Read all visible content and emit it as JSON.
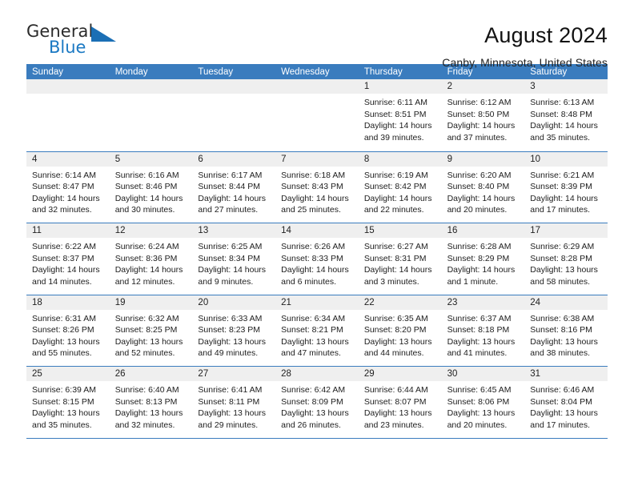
{
  "brand": {
    "name_top": "General",
    "name_bottom": "Blue",
    "accent_color": "#1b79c3",
    "triangle_color": "#1b6fb5"
  },
  "header": {
    "title": "August 2024",
    "subtitle": "Canby, Minnesota, United States",
    "header_bg_color": "#3a7cbe",
    "daynum_bg_color": "#efefef"
  },
  "weekdays": [
    "Sunday",
    "Monday",
    "Tuesday",
    "Wednesday",
    "Thursday",
    "Friday",
    "Saturday"
  ],
  "weeks": [
    [
      {
        "day": "",
        "lines": []
      },
      {
        "day": "",
        "lines": []
      },
      {
        "day": "",
        "lines": []
      },
      {
        "day": "",
        "lines": []
      },
      {
        "day": "1",
        "lines": [
          "Sunrise: 6:11 AM",
          "Sunset: 8:51 PM",
          "Daylight: 14 hours",
          "and 39 minutes."
        ]
      },
      {
        "day": "2",
        "lines": [
          "Sunrise: 6:12 AM",
          "Sunset: 8:50 PM",
          "Daylight: 14 hours",
          "and 37 minutes."
        ]
      },
      {
        "day": "3",
        "lines": [
          "Sunrise: 6:13 AM",
          "Sunset: 8:48 PM",
          "Daylight: 14 hours",
          "and 35 minutes."
        ]
      }
    ],
    [
      {
        "day": "4",
        "lines": [
          "Sunrise: 6:14 AM",
          "Sunset: 8:47 PM",
          "Daylight: 14 hours",
          "and 32 minutes."
        ]
      },
      {
        "day": "5",
        "lines": [
          "Sunrise: 6:16 AM",
          "Sunset: 8:46 PM",
          "Daylight: 14 hours",
          "and 30 minutes."
        ]
      },
      {
        "day": "6",
        "lines": [
          "Sunrise: 6:17 AM",
          "Sunset: 8:44 PM",
          "Daylight: 14 hours",
          "and 27 minutes."
        ]
      },
      {
        "day": "7",
        "lines": [
          "Sunrise: 6:18 AM",
          "Sunset: 8:43 PM",
          "Daylight: 14 hours",
          "and 25 minutes."
        ]
      },
      {
        "day": "8",
        "lines": [
          "Sunrise: 6:19 AM",
          "Sunset: 8:42 PM",
          "Daylight: 14 hours",
          "and 22 minutes."
        ]
      },
      {
        "day": "9",
        "lines": [
          "Sunrise: 6:20 AM",
          "Sunset: 8:40 PM",
          "Daylight: 14 hours",
          "and 20 minutes."
        ]
      },
      {
        "day": "10",
        "lines": [
          "Sunrise: 6:21 AM",
          "Sunset: 8:39 PM",
          "Daylight: 14 hours",
          "and 17 minutes."
        ]
      }
    ],
    [
      {
        "day": "11",
        "lines": [
          "Sunrise: 6:22 AM",
          "Sunset: 8:37 PM",
          "Daylight: 14 hours",
          "and 14 minutes."
        ]
      },
      {
        "day": "12",
        "lines": [
          "Sunrise: 6:24 AM",
          "Sunset: 8:36 PM",
          "Daylight: 14 hours",
          "and 12 minutes."
        ]
      },
      {
        "day": "13",
        "lines": [
          "Sunrise: 6:25 AM",
          "Sunset: 8:34 PM",
          "Daylight: 14 hours",
          "and 9 minutes."
        ]
      },
      {
        "day": "14",
        "lines": [
          "Sunrise: 6:26 AM",
          "Sunset: 8:33 PM",
          "Daylight: 14 hours",
          "and 6 minutes."
        ]
      },
      {
        "day": "15",
        "lines": [
          "Sunrise: 6:27 AM",
          "Sunset: 8:31 PM",
          "Daylight: 14 hours",
          "and 3 minutes."
        ]
      },
      {
        "day": "16",
        "lines": [
          "Sunrise: 6:28 AM",
          "Sunset: 8:29 PM",
          "Daylight: 14 hours",
          "and 1 minute."
        ]
      },
      {
        "day": "17",
        "lines": [
          "Sunrise: 6:29 AM",
          "Sunset: 8:28 PM",
          "Daylight: 13 hours",
          "and 58 minutes."
        ]
      }
    ],
    [
      {
        "day": "18",
        "lines": [
          "Sunrise: 6:31 AM",
          "Sunset: 8:26 PM",
          "Daylight: 13 hours",
          "and 55 minutes."
        ]
      },
      {
        "day": "19",
        "lines": [
          "Sunrise: 6:32 AM",
          "Sunset: 8:25 PM",
          "Daylight: 13 hours",
          "and 52 minutes."
        ]
      },
      {
        "day": "20",
        "lines": [
          "Sunrise: 6:33 AM",
          "Sunset: 8:23 PM",
          "Daylight: 13 hours",
          "and 49 minutes."
        ]
      },
      {
        "day": "21",
        "lines": [
          "Sunrise: 6:34 AM",
          "Sunset: 8:21 PM",
          "Daylight: 13 hours",
          "and 47 minutes."
        ]
      },
      {
        "day": "22",
        "lines": [
          "Sunrise: 6:35 AM",
          "Sunset: 8:20 PM",
          "Daylight: 13 hours",
          "and 44 minutes."
        ]
      },
      {
        "day": "23",
        "lines": [
          "Sunrise: 6:37 AM",
          "Sunset: 8:18 PM",
          "Daylight: 13 hours",
          "and 41 minutes."
        ]
      },
      {
        "day": "24",
        "lines": [
          "Sunrise: 6:38 AM",
          "Sunset: 8:16 PM",
          "Daylight: 13 hours",
          "and 38 minutes."
        ]
      }
    ],
    [
      {
        "day": "25",
        "lines": [
          "Sunrise: 6:39 AM",
          "Sunset: 8:15 PM",
          "Daylight: 13 hours",
          "and 35 minutes."
        ]
      },
      {
        "day": "26",
        "lines": [
          "Sunrise: 6:40 AM",
          "Sunset: 8:13 PM",
          "Daylight: 13 hours",
          "and 32 minutes."
        ]
      },
      {
        "day": "27",
        "lines": [
          "Sunrise: 6:41 AM",
          "Sunset: 8:11 PM",
          "Daylight: 13 hours",
          "and 29 minutes."
        ]
      },
      {
        "day": "28",
        "lines": [
          "Sunrise: 6:42 AM",
          "Sunset: 8:09 PM",
          "Daylight: 13 hours",
          "and 26 minutes."
        ]
      },
      {
        "day": "29",
        "lines": [
          "Sunrise: 6:44 AM",
          "Sunset: 8:07 PM",
          "Daylight: 13 hours",
          "and 23 minutes."
        ]
      },
      {
        "day": "30",
        "lines": [
          "Sunrise: 6:45 AM",
          "Sunset: 8:06 PM",
          "Daylight: 13 hours",
          "and 20 minutes."
        ]
      },
      {
        "day": "31",
        "lines": [
          "Sunrise: 6:46 AM",
          "Sunset: 8:04 PM",
          "Daylight: 13 hours",
          "and 17 minutes."
        ]
      }
    ]
  ]
}
